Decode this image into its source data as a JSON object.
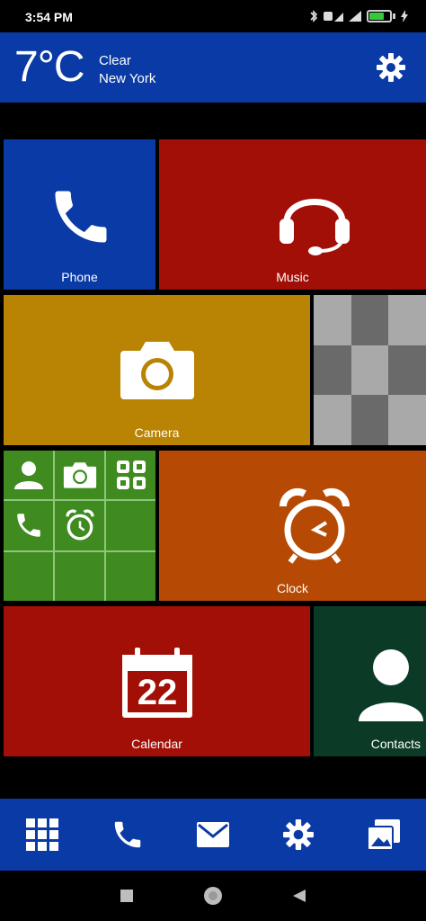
{
  "status": {
    "time": "3:54 PM"
  },
  "weather": {
    "temperature": "7°C",
    "condition": "Clear",
    "city": "New York"
  },
  "tiles": {
    "phone": {
      "label": "Phone",
      "color": "#0a3aa5"
    },
    "music": {
      "label": "Music",
      "color": "#a20f07"
    },
    "camera": {
      "label": "Camera",
      "color": "#b98303"
    },
    "clock": {
      "label": "Clock",
      "color": "#b64a04"
    },
    "calendar": {
      "label": "Calendar",
      "day": "22",
      "color": "#a20f07"
    },
    "contacts": {
      "label": "Contacts",
      "color": "#0b3b26"
    },
    "folder_color": "#3f8b1f"
  },
  "icons": {
    "settings": "gear-icon",
    "dock": [
      "apps-grid-icon",
      "phone-icon",
      "mail-icon",
      "gear-icon",
      "gallery-icon"
    ],
    "nav": [
      "recents-square-icon",
      "home-circle-icon",
      "back-triangle-icon"
    ]
  },
  "colors": {
    "accent": "#0a3aa5",
    "background": "#000000"
  }
}
